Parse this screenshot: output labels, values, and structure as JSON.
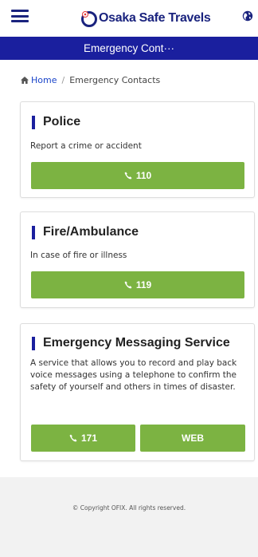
{
  "header": {
    "brand": "Osaka Safe Travels",
    "title": "Emergency Cont···"
  },
  "breadcrumb": {
    "home": "Home",
    "separator": "/",
    "current": "Emergency Contacts"
  },
  "cards": [
    {
      "title": "Police",
      "description": "Report a crime or accident",
      "buttons": [
        {
          "label": "110"
        }
      ]
    },
    {
      "title": "Fire/Ambulance",
      "description": "In case of fire or illness",
      "buttons": [
        {
          "label": "119"
        }
      ]
    },
    {
      "title": "Emergency Messaging Service",
      "description": "A service that allows you to record and play back voice messages using a telephone to confirm the safety of yourself and others in times of disaster.",
      "buttons": [
        {
          "label": "171"
        },
        {
          "label": "WEB"
        }
      ]
    }
  ],
  "footer": {
    "copyright": "© Copyright OFIX. All rights reserved."
  },
  "colors": {
    "brand": "#1a237e",
    "title_bar": "#1a1f9e",
    "button": "#7cb342",
    "link": "#1a44c9"
  },
  "icons": [
    "menu-icon",
    "logo-mark-icon",
    "globe-icon",
    "home-icon",
    "phone-icon"
  ]
}
